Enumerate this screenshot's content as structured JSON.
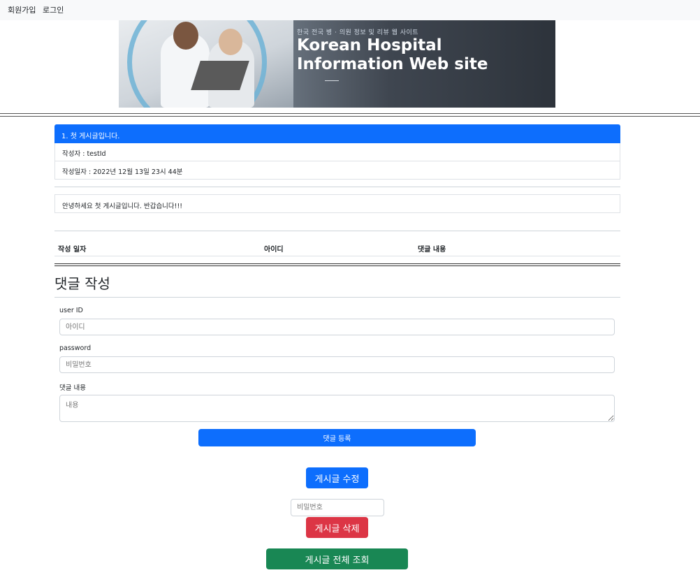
{
  "nav": {
    "signup": "회원가입",
    "login": "로그인"
  },
  "banner": {
    "subtitle": "한국 전국 병 · 의원 정보 및 리뷰 웹 사이트",
    "title_line1": "Korean Hospital",
    "title_line2": "Information Web site"
  },
  "post": {
    "title": "1. 첫 게시글입니다.",
    "author": "작성자 : testId",
    "date": "작성일자 : 2022년 12월 13일 23시 44분",
    "content": "안녕하세요 첫 게시글입니다. 반갑습니다!!!"
  },
  "comments_table": {
    "col_date": "작성 일자",
    "col_id": "아이디",
    "col_content": "댓글 내용"
  },
  "comment_form": {
    "heading": "댓글 작성",
    "userid_label": "user ID",
    "userid_placeholder": "아이디",
    "password_label": "password",
    "password_placeholder": "비밀번호",
    "content_label": "댓글 내용",
    "content_placeholder": "내용",
    "submit_label": "댓글 등록"
  },
  "actions": {
    "edit_label": "게시글 수정",
    "delete_password_placeholder": "비밀번호",
    "delete_label": "게시글 삭제",
    "list_label": "게시글 전체 조회"
  },
  "colors": {
    "primary": "#0d6efd",
    "danger": "#dc3545",
    "success": "#198754"
  }
}
